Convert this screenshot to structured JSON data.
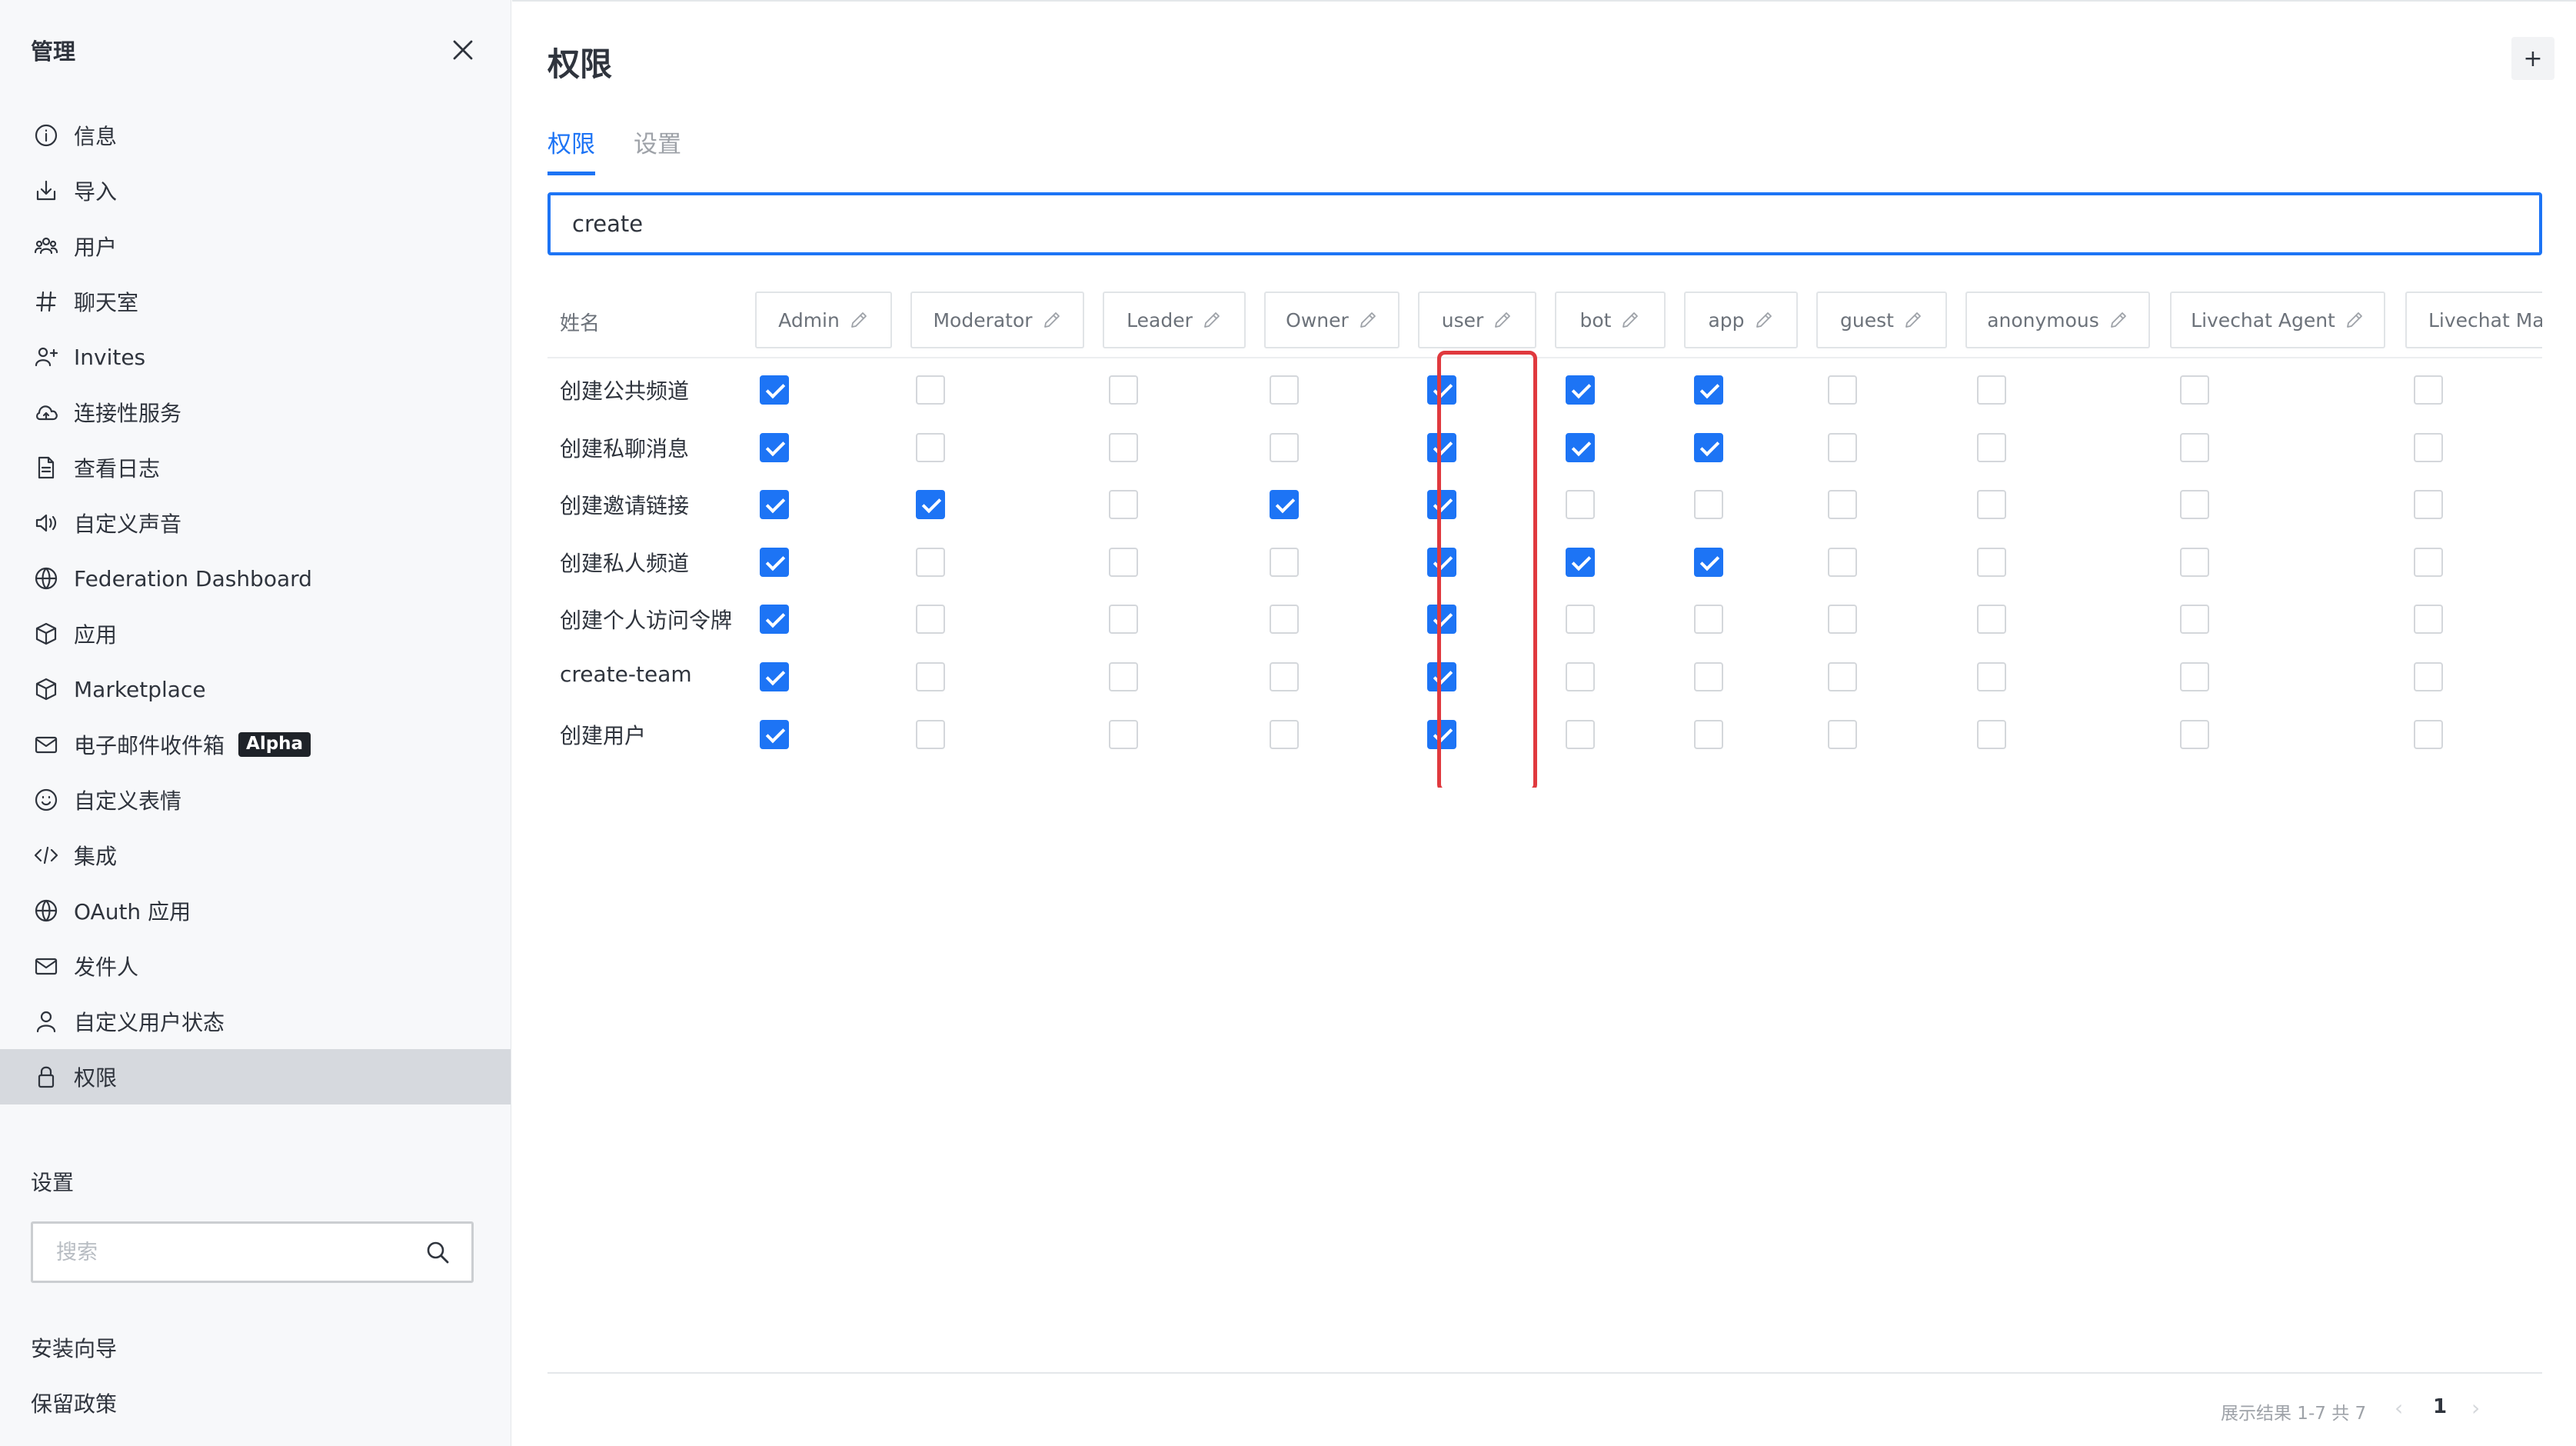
{
  "sidebar": {
    "title": "管理",
    "items": [
      {
        "label": "信息",
        "icon": "info-icon"
      },
      {
        "label": "导入",
        "icon": "import-icon"
      },
      {
        "label": "用户",
        "icon": "users-icon"
      },
      {
        "label": "聊天室",
        "icon": "hashtag-icon"
      },
      {
        "label": "Invites",
        "icon": "user-plus-icon"
      },
      {
        "label": "连接性服务",
        "icon": "cloud-icon"
      },
      {
        "label": "查看日志",
        "icon": "file-icon"
      },
      {
        "label": "自定义声音",
        "icon": "speaker-icon"
      },
      {
        "label": "Federation Dashboard",
        "icon": "globe-icon"
      },
      {
        "label": "应用",
        "icon": "cube-icon"
      },
      {
        "label": "Marketplace",
        "icon": "cube-icon"
      },
      {
        "label": "电子邮件收件箱",
        "icon": "mail-icon",
        "badge": "Alpha"
      },
      {
        "label": "自定义表情",
        "icon": "emoji-icon"
      },
      {
        "label": "集成",
        "icon": "code-icon"
      },
      {
        "label": "OAuth 应用",
        "icon": "globe-icon"
      },
      {
        "label": "发件人",
        "icon": "mail-icon"
      },
      {
        "label": "自定义用户状态",
        "icon": "user-icon"
      },
      {
        "label": "权限",
        "icon": "lock-icon",
        "active": true
      }
    ],
    "settings_heading": "设置",
    "search_placeholder": "搜索",
    "footer_links": [
      "安装向导",
      "保留政策"
    ]
  },
  "main": {
    "title": "权限",
    "add_label": "+",
    "tabs": [
      {
        "label": "权限",
        "active": true
      },
      {
        "label": "设置",
        "active": false
      }
    ],
    "filter_value": "create",
    "name_header": "姓名",
    "roles": [
      "Admin",
      "Moderator",
      "Leader",
      "Owner",
      "user",
      "bot",
      "app",
      "guest",
      "anonymous",
      "Livechat Agent",
      "Livechat Ma"
    ],
    "permissions": [
      {
        "name": "创建公共频道",
        "checks": [
          true,
          false,
          false,
          false,
          true,
          true,
          true,
          false,
          false,
          false,
          false
        ]
      },
      {
        "name": "创建私聊消息",
        "checks": [
          true,
          false,
          false,
          false,
          true,
          true,
          true,
          false,
          false,
          false,
          false
        ]
      },
      {
        "name": "创建邀请链接",
        "checks": [
          true,
          true,
          false,
          true,
          true,
          false,
          false,
          false,
          false,
          false,
          false
        ]
      },
      {
        "name": "创建私人频道",
        "checks": [
          true,
          false,
          false,
          false,
          true,
          true,
          true,
          false,
          false,
          false,
          false
        ]
      },
      {
        "name": "创建个人访问令牌",
        "checks": [
          true,
          false,
          false,
          false,
          true,
          false,
          false,
          false,
          false,
          false,
          false
        ]
      },
      {
        "name": "create-team",
        "checks": [
          true,
          false,
          false,
          false,
          true,
          false,
          false,
          false,
          false,
          false,
          false
        ]
      },
      {
        "name": "创建用户",
        "checks": [
          true,
          false,
          false,
          false,
          true,
          false,
          false,
          false,
          false,
          false,
          false
        ]
      }
    ],
    "highlighted_role": "user",
    "highlight_color": "#e0393e",
    "accent_color": "#1d74f5",
    "pagination": {
      "info": "展示结果 1-7 共 7",
      "prev": "‹",
      "current_page": "1",
      "next": "›"
    }
  }
}
